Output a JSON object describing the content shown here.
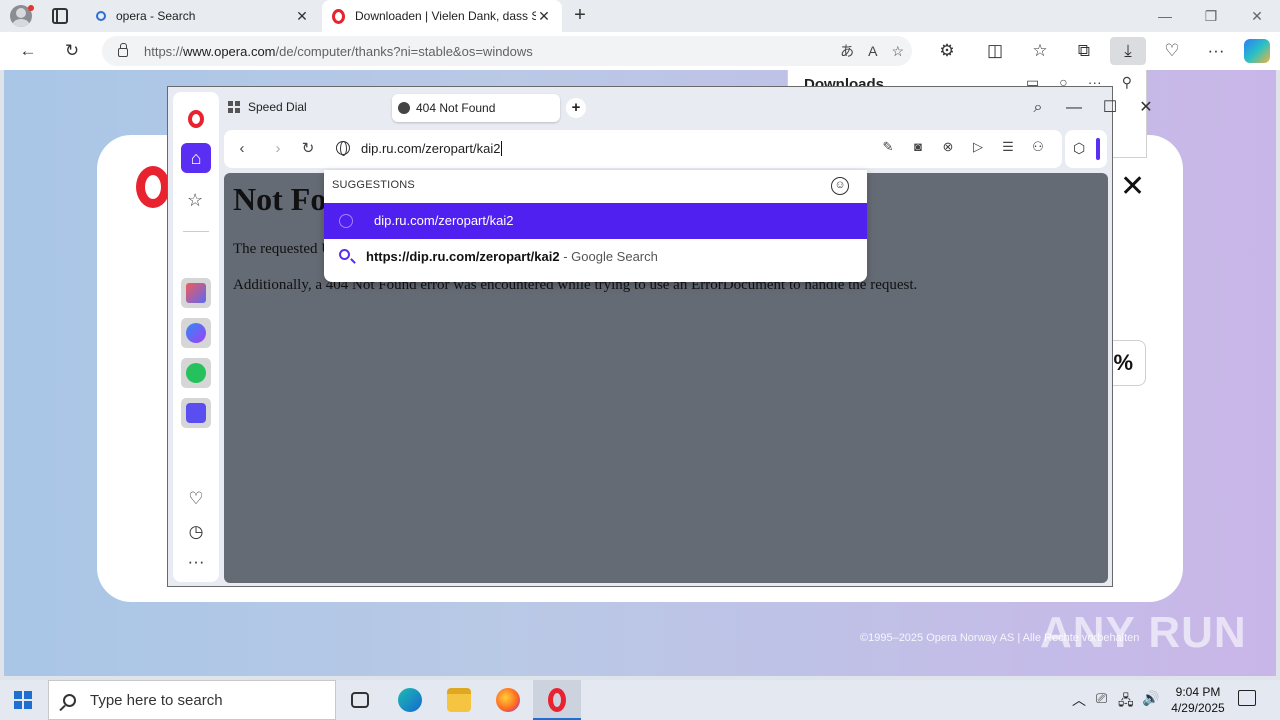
{
  "edge": {
    "tabs": [
      {
        "title": "opera - Search",
        "favicon": "search-icon"
      },
      {
        "title": "Downloaden | Vielen Dank, dass Sie",
        "favicon": "opera-icon"
      }
    ],
    "address": {
      "prefix": "https://",
      "host": "www.opera.com",
      "path": "/de/computer/thanks?ni=stable&os=windows"
    },
    "downloads_panel_title": "Downloads"
  },
  "page": {
    "percent": "0%",
    "copyright": "©1995–2025 Opera Norway AS | Alle Rechte vorbehalten"
  },
  "opera": {
    "speed_dial": "Speed Dial",
    "active_tab": "404 Not Found",
    "url": "dip.ru.com/zeropart/kai2",
    "content": {
      "heading": "Not Found",
      "p1": "The requested URL was not found on this server.",
      "p2": "Additionally, a 404 Not Found error was encountered while trying to use an ErrorDocument to handle the request."
    },
    "suggestions": {
      "header": "SUGGESTIONS",
      "items": [
        {
          "text": "dip.ru.com/zeropart/kai2"
        },
        {
          "text": "https://dip.ru.com/zeropart/kai2",
          "suffix": " - Google Search"
        }
      ]
    },
    "accent_color": "#5b2ef3"
  },
  "taskbar": {
    "search_placeholder": "Type here to search",
    "time": "9:04 PM",
    "date": "4/29/2025"
  },
  "watermark": "ANY RUN"
}
